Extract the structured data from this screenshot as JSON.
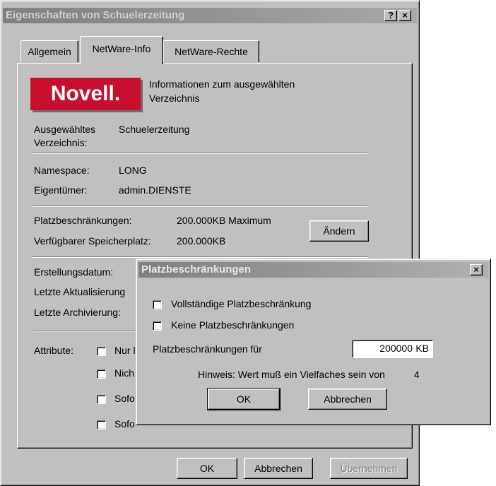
{
  "main_dialog": {
    "title": "Eigenschaften von Schuelerzeitung",
    "help_button": "?",
    "close_button": "×",
    "tabs": [
      "Allgemein",
      "NetWare-Info",
      "NetWare-Rechte"
    ],
    "active_tab": "NetWare-Info",
    "logo_text": "Novell.",
    "info_text_line1": "Informationen zum ausgewählten",
    "info_text_line2": "Verzeichnis",
    "selected_dir_label_line1": "Ausgewähltes",
    "selected_dir_label_line2": "Verzeichnis:",
    "selected_dir_value": "Schuelerzeitung",
    "namespace_label": "Namespace:",
    "namespace_value": "LONG",
    "owner_label": "Eigentümer:",
    "owner_value": "admin.DIENSTE",
    "quota_label": "Platzbeschränkungen:",
    "quota_value": "200.000KB Maximum",
    "space_label": "Verfügbarer Speicherplatz:",
    "space_value": "200.000KB",
    "change_button": "Ändern",
    "created_label": "Erstellungsdatum:",
    "updated_label": "Letzte Aktualisierung",
    "archived_label": "Letzte Archivierung:",
    "attributes_label": "Attribute:",
    "attributes": [
      "Nur l",
      "Nich",
      "Sofo",
      "Sofo"
    ],
    "ok_button": "OK",
    "cancel_button": "Abbrechen",
    "apply_button": "Übernehmen"
  },
  "quota_dialog": {
    "title": "Platzbeschränkungen",
    "close_button": "×",
    "full_restriction_label": "Vollständige Platzbeschränkung",
    "no_restriction_label": "Keine Platzbeschränkungen",
    "restriction_for_label": "Platzbeschränkungen für",
    "restriction_value": "200000",
    "unit": "KB",
    "hint_text": "Hinweis: Wert muß ein Vielfaches sein von",
    "hint_value": "4",
    "ok_button": "OK",
    "cancel_button": "Abbrechen"
  },
  "colors": {
    "face": "#c0c0c0",
    "novell_red": "#c8102e",
    "inactive_title": "#808080"
  }
}
